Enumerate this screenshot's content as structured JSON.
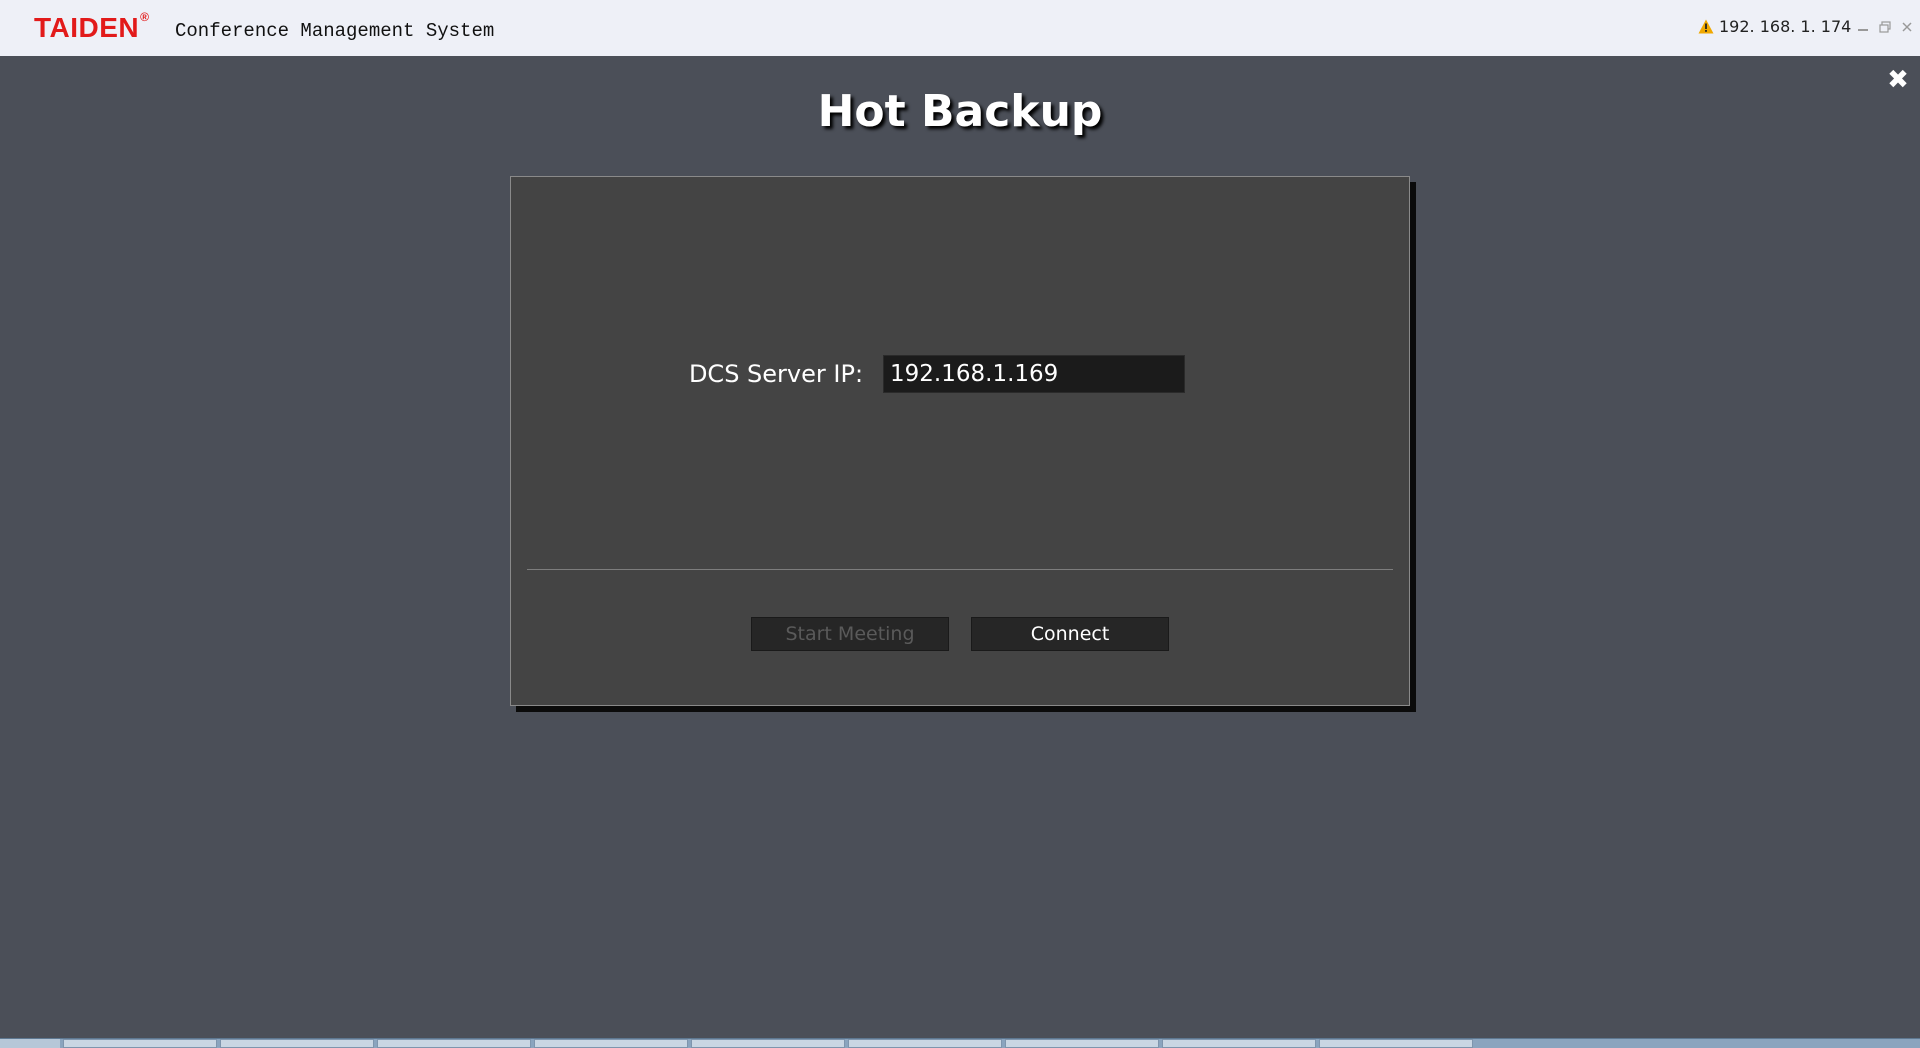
{
  "titlebar": {
    "brand": "TAIDEN",
    "brand_mark": "®",
    "app_title": "Conference Management System",
    "server_ip": "192. 168. 1. 174",
    "icons": [
      "warning-icon",
      "minimize-icon",
      "restore-icon",
      "close-icon"
    ]
  },
  "main": {
    "page_title": "Hot Backup",
    "close_glyph": "✖"
  },
  "dialog": {
    "label": "DCS Server IP:",
    "ip_value": "192.168.1.169",
    "start_button": "Start Meeting",
    "connect_button": "Connect"
  },
  "colors": {
    "brand": "#e21a1a",
    "background": "#4b4f58",
    "dialog": "#444444",
    "titlebar": "#eef0f7",
    "warning": "#f0a800"
  }
}
